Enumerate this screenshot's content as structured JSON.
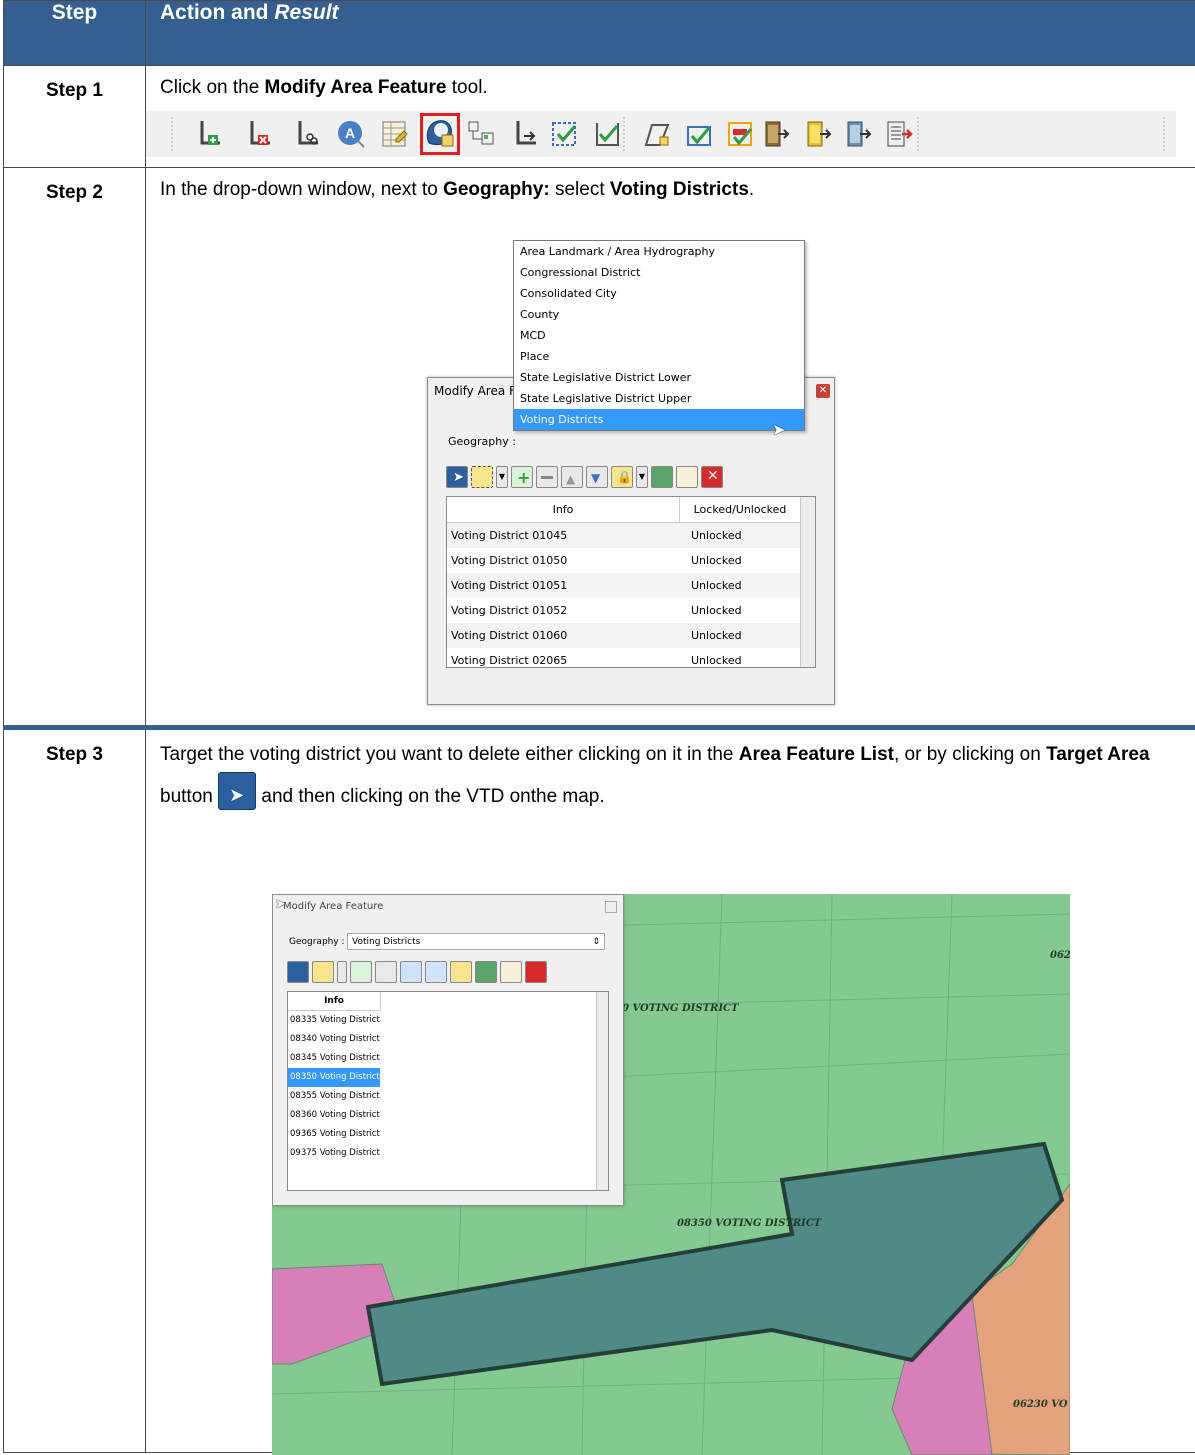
{
  "table": {
    "headers": {
      "step": "Step",
      "action": "Action and ",
      "result": "Result"
    }
  },
  "steps": [
    {
      "label": "Step 1",
      "text_pre": "Click on the ",
      "bold": "Modify Area Feature",
      "text_post": " tool."
    },
    {
      "label": "Step 2",
      "text_pre": "In the drop-down window, next to ",
      "bold1": "Geography:",
      "text_mid": " select ",
      "bold2": "Voting Districts",
      "text_post": "."
    },
    {
      "label": "Step 3",
      "text1": "Target the voting district you want to delete either clicking on it in the ",
      "bold1": "Area Feature List",
      "text2": ", or by clicking on ",
      "bold2": "Target Area",
      "text3": " button ",
      "text4": " and then clicking on the VTD onthe map."
    }
  ],
  "toolbar": {
    "icons": [
      "add-vertex-icon",
      "delete-vertex-icon",
      "split-line-icon",
      "label-icon",
      "attribute-table-icon",
      "modify-area-feature-icon",
      "split-feature-icon",
      "move-vertex-icon",
      "select-check-icon",
      "check-edit-icon",
      "polygon-icon",
      "check-icon",
      "review-icon",
      "export-1-icon",
      "export-2-icon",
      "export-3-icon",
      "export-4-icon"
    ],
    "highlight_color": "#e02020"
  },
  "dialog1": {
    "title": "Modify Area Fe",
    "geography_label": "Geography :",
    "dropdown_options": [
      "Area Landmark / Area Hydrography",
      "Congressional District",
      "Consolidated City",
      "County",
      "MCD",
      "Place",
      "State Legislative District Lower",
      "State Legislative District Upper",
      "Voting Districts"
    ],
    "selected": "Voting Districts",
    "columns": [
      "Info",
      "Locked/Unlocked"
    ],
    "rows": [
      [
        "Voting District 01045",
        "Unlocked"
      ],
      [
        "Voting District 01050",
        "Unlocked"
      ],
      [
        "Voting District 01051",
        "Unlocked"
      ],
      [
        "Voting District 01052",
        "Unlocked"
      ],
      [
        "Voting District 01060",
        "Unlocked"
      ],
      [
        "Voting District 02065",
        "Unlocked"
      ]
    ]
  },
  "dialog2": {
    "title": "Modify Area Feature",
    "geography_label": "Geography :",
    "geography_value": "Voting Districts",
    "column": "Info",
    "rows": [
      "08335 Voting District",
      "08340 Voting District",
      "08345 Voting District",
      "08350 Voting District",
      "08355 Voting District",
      "08360 Voting District",
      "09365 Voting District",
      "09375 Voting District"
    ],
    "selected_row": "08350 Voting District"
  },
  "map": {
    "labels": {
      "top_right": "062",
      "upper": "0 VOTING DISTRICT",
      "center": "08350 VOTING DISTRICT",
      "bottom_right": "06230 VO"
    },
    "colors": {
      "green": "#84c98f",
      "selected": "#4f8a86",
      "pink": "#d77fb8",
      "orange": "#e4a37c"
    }
  }
}
